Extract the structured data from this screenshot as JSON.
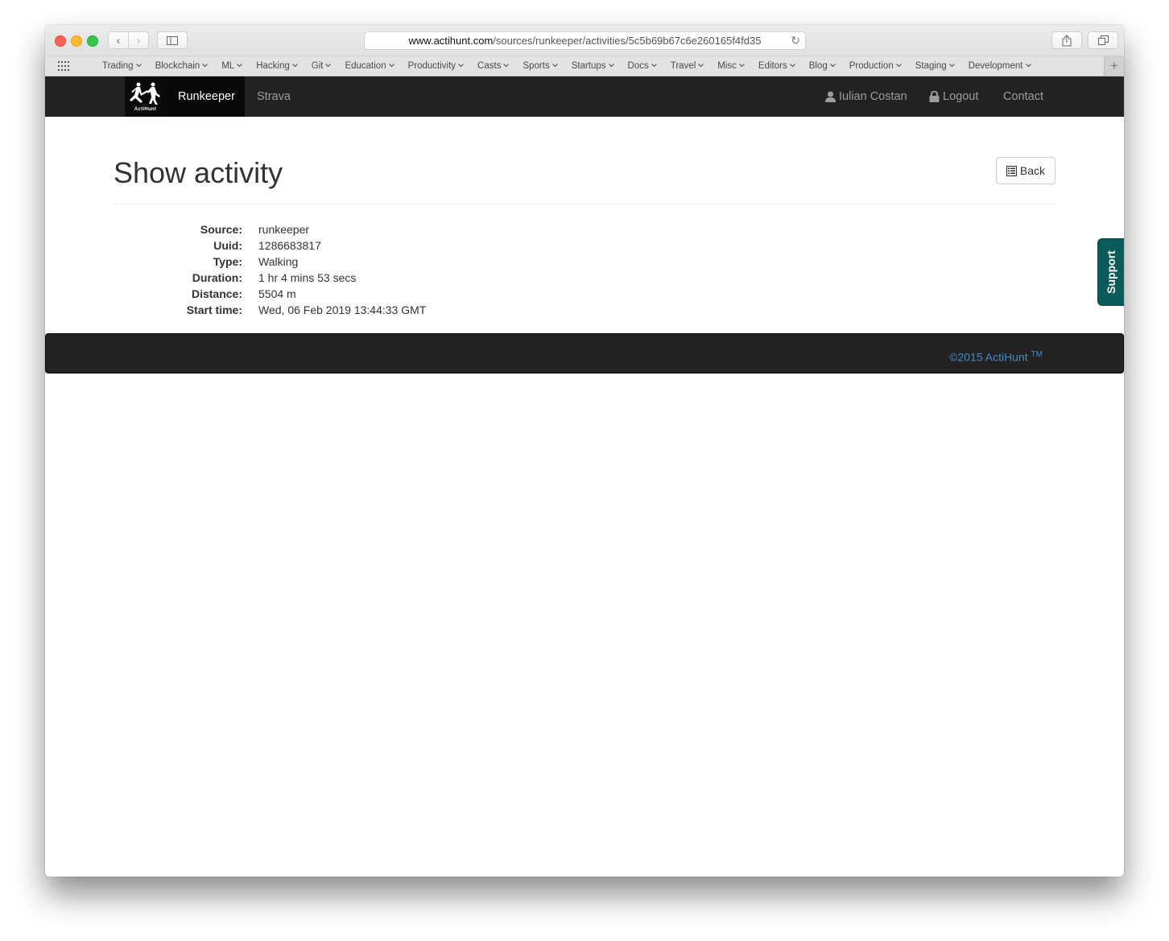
{
  "browser": {
    "url_host": "www.actihunt.com",
    "url_path": "/sources/runkeeper/activities/5c5b69b67c6e260165f4fd35",
    "bookmarks": [
      "Trading",
      "Blockchain",
      "ML",
      "Hacking",
      "Git",
      "Education",
      "Productivity",
      "Casts",
      "Sports",
      "Startups",
      "Docs",
      "Travel",
      "Misc",
      "Editors",
      "Blog",
      "Production",
      "Staging",
      "Development"
    ]
  },
  "navbar": {
    "brand": "ActiHunt",
    "items": [
      {
        "label": "Runkeeper",
        "active": true
      },
      {
        "label": "Strava",
        "active": false
      }
    ],
    "user_name": "Iulian Costan",
    "logout": "Logout",
    "contact": "Contact"
  },
  "page": {
    "title": "Show activity",
    "back_label": "Back",
    "fields": [
      {
        "label": "Source:",
        "value": "runkeeper"
      },
      {
        "label": "Uuid:",
        "value": "1286683817"
      },
      {
        "label": "Type:",
        "value": "Walking"
      },
      {
        "label": "Duration:",
        "value": "1 hr 4 mins 53 secs"
      },
      {
        "label": "Distance:",
        "value": "5504 m"
      },
      {
        "label": "Start time:",
        "value": "Wed, 06 Feb 2019 13:44:33 GMT"
      }
    ]
  },
  "footer": {
    "copyright": "©2015 ActiHunt",
    "tm": "TM"
  },
  "support": {
    "label": "Support",
    "color": "#0b5b5b"
  }
}
